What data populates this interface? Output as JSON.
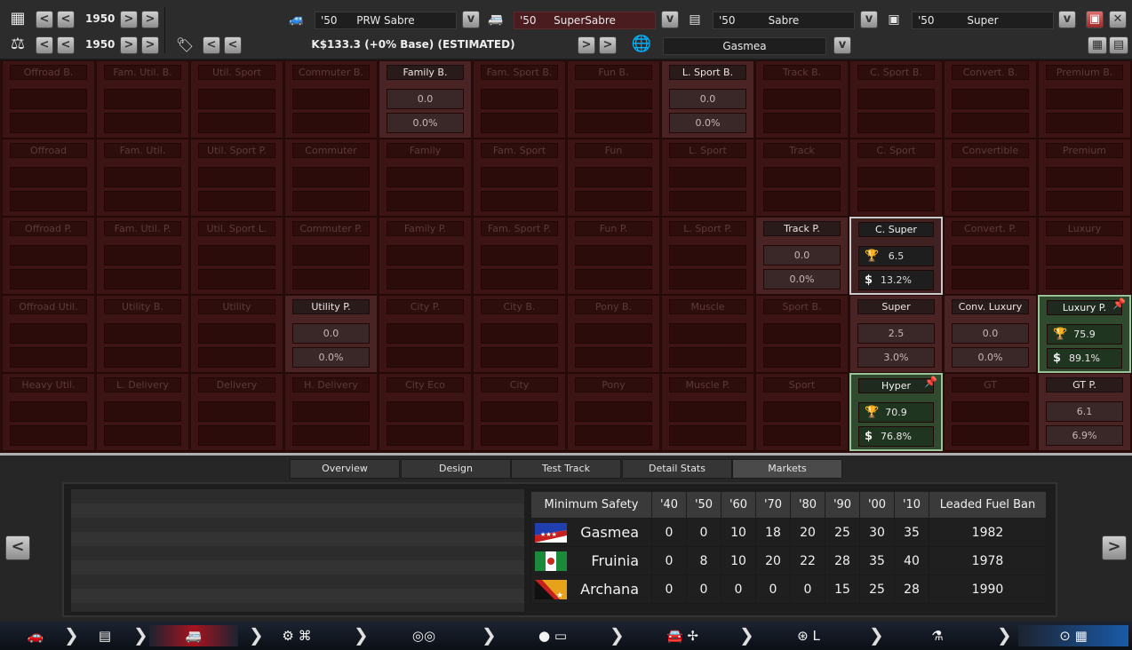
{
  "top": {
    "year1": "1950",
    "year2": "1950",
    "price": "K$133.3 (+0% Base) (ESTIMATED)",
    "market": "Gasmea",
    "slots": [
      {
        "year": "'50",
        "name": "PRW Sabre"
      },
      {
        "year": "'50",
        "name": "SuperSabre"
      },
      {
        "year": "'50",
        "name": "Sabre"
      },
      {
        "year": "'50",
        "name": "Super"
      }
    ]
  },
  "grid": {
    "rows": [
      [
        {
          "label": "Offroad B.",
          "v1": "",
          "v2": ""
        },
        {
          "label": "Fam. Util. B.",
          "v1": "",
          "v2": ""
        },
        {
          "label": "Util. Sport",
          "v1": "",
          "v2": ""
        },
        {
          "label": "Commuter B.",
          "v1": "",
          "v2": ""
        },
        {
          "label": "Family B.",
          "v1": "0.0",
          "v2": "0.0%"
        },
        {
          "label": "Fam. Sport B.",
          "v1": "",
          "v2": ""
        },
        {
          "label": "Fun B.",
          "v1": "",
          "v2": ""
        },
        {
          "label": "L. Sport B.",
          "v1": "0.0",
          "v2": "0.0%"
        },
        {
          "label": "Track B.",
          "v1": "",
          "v2": ""
        },
        {
          "label": "C. Sport B.",
          "v1": "",
          "v2": ""
        },
        {
          "label": "Convert. B.",
          "v1": "",
          "v2": ""
        },
        {
          "label": "Premium B.",
          "v1": "",
          "v2": ""
        }
      ],
      [
        {
          "label": "Offroad",
          "v1": "",
          "v2": ""
        },
        {
          "label": "Fam. Util.",
          "v1": "",
          "v2": ""
        },
        {
          "label": "Util. Sport P.",
          "v1": "",
          "v2": ""
        },
        {
          "label": "Commuter",
          "v1": "",
          "v2": ""
        },
        {
          "label": "Family",
          "v1": "",
          "v2": ""
        },
        {
          "label": "Fam. Sport",
          "v1": "",
          "v2": ""
        },
        {
          "label": "Fun",
          "v1": "",
          "v2": ""
        },
        {
          "label": "L. Sport",
          "v1": "",
          "v2": ""
        },
        {
          "label": "Track",
          "v1": "",
          "v2": ""
        },
        {
          "label": "C. Sport",
          "v1": "",
          "v2": ""
        },
        {
          "label": "Convertible",
          "v1": "",
          "v2": ""
        },
        {
          "label": "Premium",
          "v1": "",
          "v2": ""
        }
      ],
      [
        {
          "label": "Offroad P.",
          "v1": "",
          "v2": ""
        },
        {
          "label": "Fam. Util. P.",
          "v1": "",
          "v2": ""
        },
        {
          "label": "Util. Sport L.",
          "v1": "",
          "v2": ""
        },
        {
          "label": "Commuter P.",
          "v1": "",
          "v2": ""
        },
        {
          "label": "Family P.",
          "v1": "",
          "v2": ""
        },
        {
          "label": "Fam. Sport P.",
          "v1": "",
          "v2": ""
        },
        {
          "label": "Fun P.",
          "v1": "",
          "v2": ""
        },
        {
          "label": "L. Sport P.",
          "v1": "",
          "v2": ""
        },
        {
          "label": "Track P.",
          "v1": "0.0",
          "v2": "0.0%"
        },
        {
          "label": "C. Super",
          "v1": "6.5",
          "v2": "13.2%"
        },
        {
          "label": "Convert. P.",
          "v1": "",
          "v2": ""
        },
        {
          "label": "Luxury",
          "v1": "",
          "v2": ""
        }
      ],
      [
        {
          "label": "Offroad Util.",
          "v1": "",
          "v2": ""
        },
        {
          "label": "Utility B.",
          "v1": "",
          "v2": ""
        },
        {
          "label": "Utility",
          "v1": "",
          "v2": ""
        },
        {
          "label": "Utility P.",
          "v1": "0.0",
          "v2": "0.0%"
        },
        {
          "label": "City P.",
          "v1": "",
          "v2": ""
        },
        {
          "label": "City B.",
          "v1": "",
          "v2": ""
        },
        {
          "label": "Pony B.",
          "v1": "",
          "v2": ""
        },
        {
          "label": "Muscle",
          "v1": "",
          "v2": ""
        },
        {
          "label": "Sport B.",
          "v1": "",
          "v2": ""
        },
        {
          "label": "Super",
          "v1": "2.5",
          "v2": "3.0%"
        },
        {
          "label": "Conv. Luxury",
          "v1": "0.0",
          "v2": "0.0%"
        },
        {
          "label": "Luxury P.",
          "v1": "75.9",
          "v2": "89.1%"
        }
      ],
      [
        {
          "label": "Heavy Util.",
          "v1": "",
          "v2": ""
        },
        {
          "label": "L. Delivery",
          "v1": "",
          "v2": ""
        },
        {
          "label": "Delivery",
          "v1": "",
          "v2": ""
        },
        {
          "label": "H. Delivery",
          "v1": "",
          "v2": ""
        },
        {
          "label": "City Eco",
          "v1": "",
          "v2": ""
        },
        {
          "label": "City",
          "v1": "",
          "v2": ""
        },
        {
          "label": "Pony",
          "v1": "",
          "v2": ""
        },
        {
          "label": "Muscle P.",
          "v1": "",
          "v2": ""
        },
        {
          "label": "Sport",
          "v1": "",
          "v2": ""
        },
        {
          "label": "Hyper",
          "v1": "70.9",
          "v2": "76.8%"
        },
        {
          "label": "GT",
          "v1": "",
          "v2": ""
        },
        {
          "label": "GT P.",
          "v1": "6.1",
          "v2": "6.9%"
        }
      ]
    ]
  },
  "tabs": [
    "Overview",
    "Design",
    "Test Track",
    "Detail Stats",
    "Markets"
  ],
  "safety": {
    "headers": [
      "Minimum Safety",
      "'40",
      "'50",
      "'60",
      "'70",
      "'80",
      "'90",
      "'00",
      "'10",
      "Leaded Fuel Ban"
    ],
    "rows": [
      {
        "country": "Gasmea",
        "values": [
          "0",
          "0",
          "10",
          "18",
          "20",
          "25",
          "30",
          "35"
        ],
        "ban": "1982"
      },
      {
        "country": "Fruinia",
        "values": [
          "0",
          "8",
          "10",
          "20",
          "22",
          "28",
          "35",
          "40"
        ],
        "ban": "1978"
      },
      {
        "country": "Archana",
        "values": [
          "0",
          "0",
          "0",
          "0",
          "0",
          "15",
          "25",
          "28"
        ],
        "ban": "1990"
      }
    ]
  },
  "nav": {
    "items": [
      "car-icon",
      "engine-block-icon",
      "trim-icon",
      "gear-engine-icon",
      "wheels-icon",
      "body-icon",
      "fan-icon",
      "steering-icon",
      "fuel-icon",
      "finish-icon"
    ]
  }
}
